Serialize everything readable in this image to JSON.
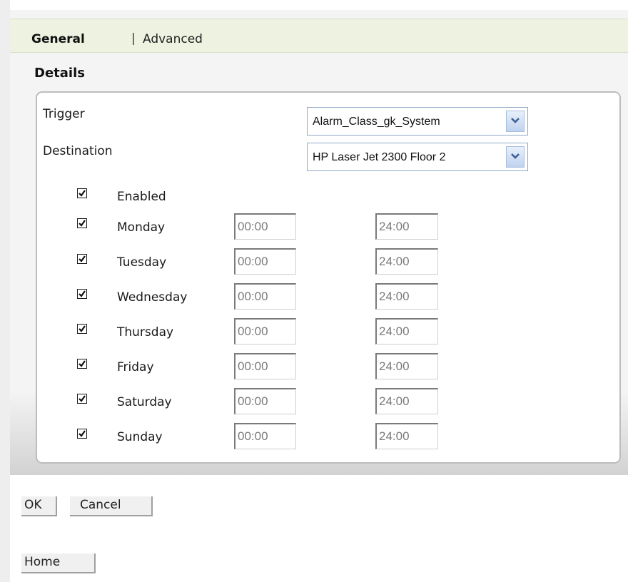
{
  "tabs": {
    "general": "General",
    "separator": "|",
    "advanced": "Advanced"
  },
  "details": {
    "title": "Details",
    "trigger_label": "Trigger",
    "trigger_value": "Alarm_Class_gk_System",
    "destination_label": "Destination",
    "destination_value": "HP Laser Jet 2300 Floor 2",
    "enabled_label": "Enabled",
    "enabled_checked": true
  },
  "schedule": [
    {
      "day": "Monday",
      "checked": true,
      "start": "00:00",
      "end": "24:00"
    },
    {
      "day": "Tuesday",
      "checked": true,
      "start": "00:00",
      "end": "24:00"
    },
    {
      "day": "Wednesday",
      "checked": true,
      "start": "00:00",
      "end": "24:00"
    },
    {
      "day": "Thursday",
      "checked": true,
      "start": "00:00",
      "end": "24:00"
    },
    {
      "day": "Friday",
      "checked": true,
      "start": "00:00",
      "end": "24:00"
    },
    {
      "day": "Saturday",
      "checked": true,
      "start": "00:00",
      "end": "24:00"
    },
    {
      "day": "Sunday",
      "checked": true,
      "start": "00:00",
      "end": "24:00"
    }
  ],
  "buttons": {
    "ok": "OK",
    "cancel": "Cancel",
    "home": "Home"
  },
  "icons": {
    "dropdown": "chevron-down-icon",
    "checkbox": "checkmark-icon"
  }
}
